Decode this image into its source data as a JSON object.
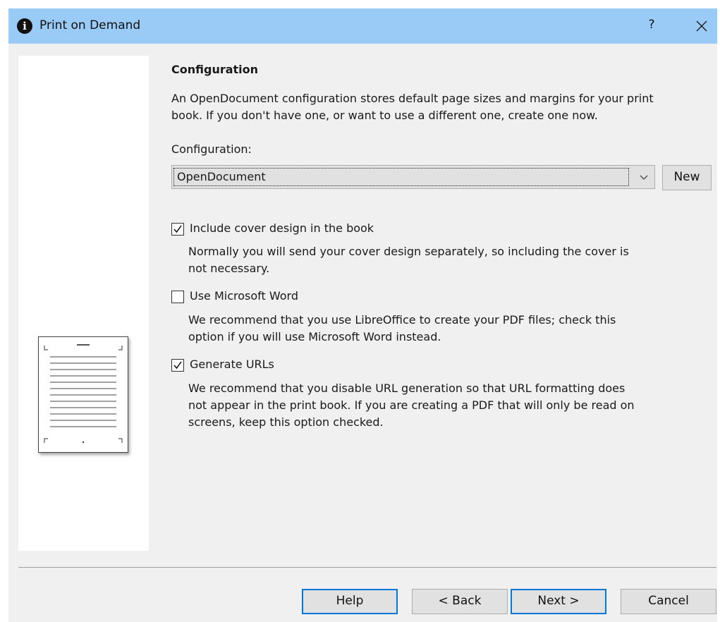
{
  "window": {
    "title": "Print on Demand",
    "app_icon": "i",
    "help_button": "?",
    "close_icon": "close-icon"
  },
  "content": {
    "section_title": "Configuration",
    "intro_line1": "An OpenDocument configuration stores default page sizes and margins for your print",
    "intro_line2": "book. If you don't have one, or want to use a different one, create one now.",
    "config_label": "Configuration:",
    "config_value": "OpenDocument",
    "new_button": "New"
  },
  "options": {
    "cover": {
      "label": "Include cover design in the book",
      "checked": true,
      "desc_line1": "Normally you will send your cover design separately, so including the cover is",
      "desc_line2": "not necessary."
    },
    "word": {
      "label": "Use Microsoft Word",
      "checked": false,
      "desc_line1": "We recommend that you use LibreOffice to create your PDF files; check this",
      "desc_line2": "option if you will use Microsoft Word instead."
    },
    "urls": {
      "label": "Generate URLs",
      "checked": true,
      "desc_line1": "We recommend that you disable URL generation so that URL formatting does",
      "desc_line2": "not appear in the print book. If you are creating a PDF that will only be read on",
      "desc_line3": "screens, keep this option checked."
    }
  },
  "footer": {
    "help": "Help",
    "back": "< Back",
    "next": "Next >",
    "cancel": "Cancel"
  },
  "colors": {
    "titlebar": "#99cbf6",
    "dialog_bg": "#f0f0f0",
    "focus_border": "#0078d7"
  }
}
